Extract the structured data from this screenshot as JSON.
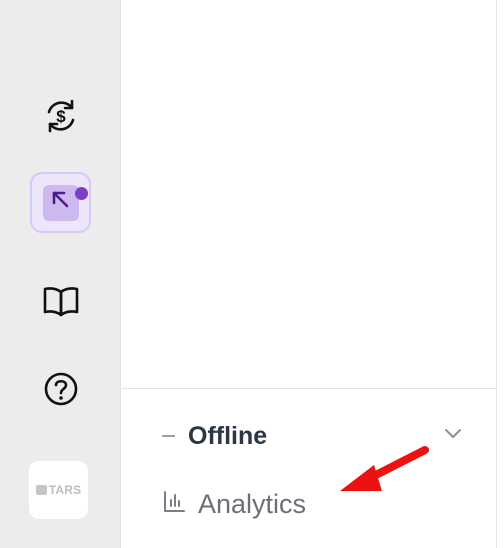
{
  "sidebar": {
    "items": [
      {
        "name": "billing",
        "icon": "dollar-refresh-icon"
      },
      {
        "name": "launch",
        "icon": "arrow-up-left-icon",
        "active": true,
        "has_notification": true
      },
      {
        "name": "docs",
        "icon": "open-book-icon"
      },
      {
        "name": "help",
        "icon": "question-circle-icon"
      }
    ],
    "brand_label": "TARS"
  },
  "panel": {
    "offline_label": "Offline",
    "analytics_label": "Analytics"
  },
  "colors": {
    "accent": "#7a3fc4",
    "active_bg": "#ede6fb",
    "annotation_arrow": "#ee1111"
  }
}
